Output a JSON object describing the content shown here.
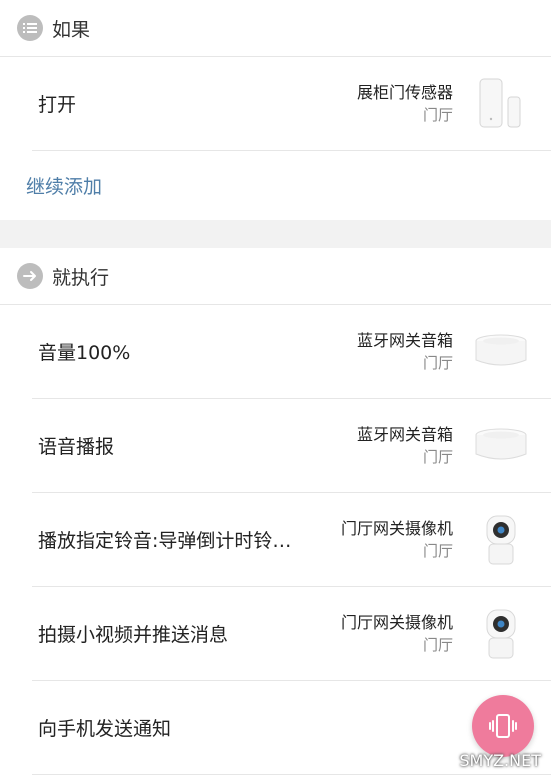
{
  "if_section": {
    "title": "如果",
    "icon": "list-icon",
    "trigger": {
      "label": "打开",
      "device_name": "展柜门传感器",
      "room": "门厅",
      "device_icon": "door-sensor-icon"
    },
    "add_more": "继续添加"
  },
  "then_section": {
    "title": "就执行",
    "icon": "arrow-right-icon",
    "actions": [
      {
        "label": "音量100%",
        "device_name": "蓝牙网关音箱",
        "room": "门厅",
        "device_icon": "gateway-speaker-icon"
      },
      {
        "label": "语音播报",
        "device_name": "蓝牙网关音箱",
        "room": "门厅",
        "device_icon": "gateway-speaker-icon"
      },
      {
        "label": "播放指定铃音:导弹倒计时铃…",
        "device_name": "门厅网关摄像机",
        "room": "门厅",
        "device_icon": "camera-icon"
      },
      {
        "label": "拍摄小视频并推送消息",
        "device_name": "门厅网关摄像机",
        "room": "门厅",
        "device_icon": "camera-icon"
      },
      {
        "label": "向手机发送通知",
        "device_name": "",
        "room": "",
        "device_icon": ""
      }
    ]
  },
  "fab": {
    "icon": "phone-vibrate-icon"
  },
  "watermark": "SMYZ.NET",
  "colors": {
    "link": "#4f7ea8",
    "fab": "#ef7b9c",
    "section_icon": "#bdbdbd"
  }
}
